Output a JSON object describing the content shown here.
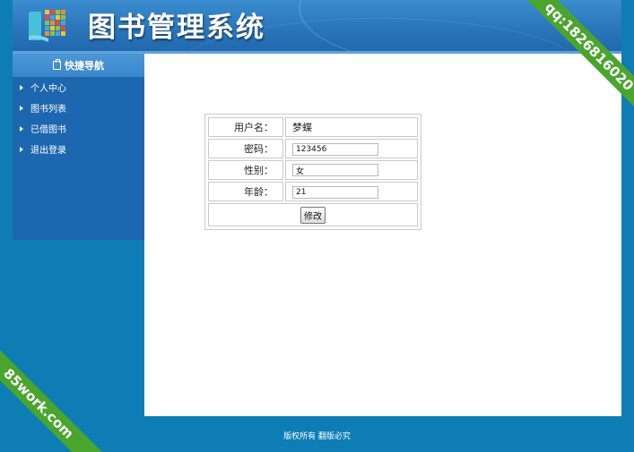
{
  "header": {
    "title": "图书管理系统"
  },
  "sidebar": {
    "heading": "快捷导航",
    "items": [
      {
        "label": "个人中心"
      },
      {
        "label": "图书列表"
      },
      {
        "label": "已借图书"
      },
      {
        "label": "退出登录"
      }
    ]
  },
  "form": {
    "username_label": "用户名：",
    "username_value": "梦蝶",
    "password_label": "密码：",
    "password_value": "123456",
    "gender_label": "性别：",
    "gender_value": "女",
    "age_label": "年龄：",
    "age_value": "21",
    "submit_label": "修改"
  },
  "footer": {
    "copyright": "版权所有 翻版必究"
  },
  "watermarks": {
    "top_right": "qq:1826816020",
    "bottom_left": "85work.com"
  },
  "colors": {
    "page_bg": "#0e7db5",
    "header_bg": "#2a74ba",
    "sidebar_bg": "#1c67b0",
    "ribbon": "#4aa52e"
  }
}
